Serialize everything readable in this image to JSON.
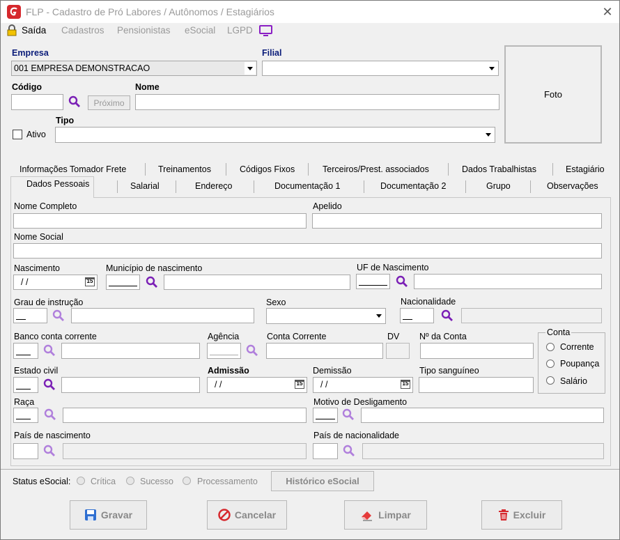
{
  "window": {
    "title": "FLP - Cadastro de Pró Labores / Autônomos / Estagiários",
    "close": "✕"
  },
  "menu": {
    "exit": "Saída",
    "items": [
      "Cadastros",
      "Pensionistas",
      "eSocial",
      "LGPD"
    ]
  },
  "header": {
    "empresa_label": "Empresa",
    "empresa_value": "001 EMPRESA DEMONSTRACAO",
    "filial_label": "Filial",
    "filial_value": "",
    "codigo_label": "Código",
    "codigo_value": "",
    "proximo_label": "Próximo",
    "nome_label": "Nome",
    "nome_value": "",
    "ativo_label": "Ativo",
    "tipo_label": "Tipo",
    "tipo_value": "",
    "foto_label": "Foto"
  },
  "tabs": {
    "row1": [
      "Informações Tomador Frete",
      "Treinamentos",
      "Códigos Fixos",
      "Terceiros/Prest. associados",
      "Dados Trabalhistas",
      "Estagiário"
    ],
    "row2": [
      "Dados Pessoais",
      "Salarial",
      "Endereço",
      "Documentação 1",
      "Documentação 2",
      "Grupo",
      "Observações"
    ],
    "active": "Dados Pessoais"
  },
  "form": {
    "nome_completo": "Nome Completo",
    "apelido": "Apelido",
    "nome_social": "Nome Social",
    "nascimento": "Nascimento",
    "nascimento_value": "/ /",
    "municipio": "Município de nascimento",
    "uf": "UF de Nascimento",
    "grau": "Grau de instrução",
    "sexo": "Sexo",
    "nacionalidade": "Nacionalidade",
    "banco": "Banco conta corrente",
    "agencia": "Agência",
    "conta_corrente": "Conta Corrente",
    "dv": "DV",
    "num_conta": "Nº da Conta",
    "conta_group": "Conta",
    "conta_options": [
      "Corrente",
      "Poupança",
      "Salário"
    ],
    "estado_civil": "Estado civil",
    "admissao": "Admissão",
    "admissao_value": "/ /",
    "demissao": "Demissão",
    "demissao_value": "/ /",
    "tipo_sanguineo": "Tipo sanguíneo",
    "raca": "Raça",
    "motivo": "Motivo de Desligamento",
    "pais_nasc": "País de nascimento",
    "pais_nac": "País de nacionalidade",
    "calendar_glyph": "15"
  },
  "status": {
    "label": "Status eSocial:",
    "options": [
      "Crítica",
      "Sucesso",
      "Processamento"
    ],
    "historico": "Histórico eSocial"
  },
  "actions": {
    "gravar": "Gravar",
    "cancelar": "Cancelar",
    "limpar": "Limpar",
    "excluir": "Excluir"
  },
  "colors": {
    "navy_label": "#0b1d7a",
    "magnifier": "#7a1fb5",
    "logo_red": "#d6282d"
  }
}
